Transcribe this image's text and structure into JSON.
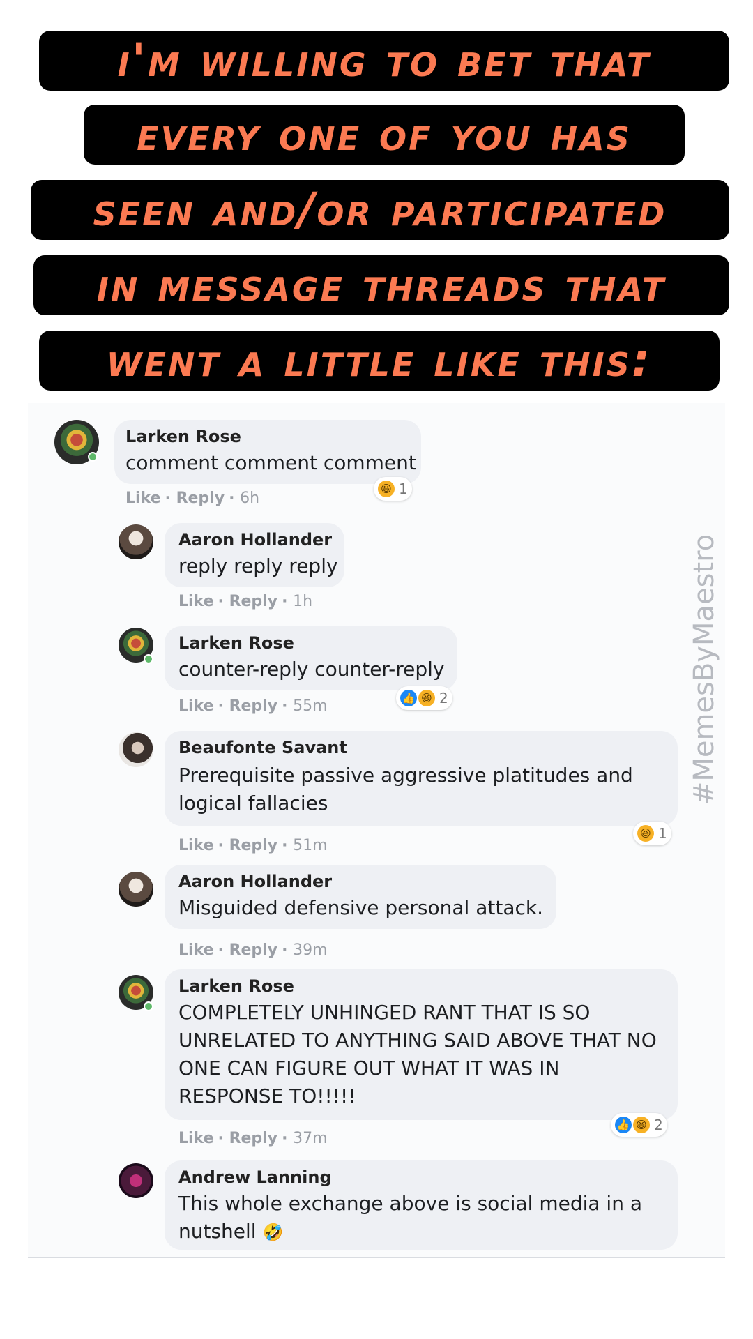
{
  "caption": {
    "lines": [
      "I'm willing to bet that",
      "every one of you has",
      "seen and/or participated",
      "in message threads that",
      "went a little like this:"
    ]
  },
  "watermark": "#MemesByMaestro",
  "comments": [
    {
      "author": "Larken Rose",
      "text": "comment comment comment",
      "like": "Like",
      "reply": "Reply",
      "time": "6h",
      "reaction_count": "1"
    },
    {
      "author": "Aaron Hollander",
      "text": "reply reply reply",
      "like": "Like",
      "reply": "Reply",
      "time": "1h"
    },
    {
      "author": "Larken Rose",
      "text": "counter-reply counter-reply",
      "like": "Like",
      "reply": "Reply",
      "time": "55m",
      "reaction_count": "2"
    },
    {
      "author": "Beaufonte Savant",
      "text": "Prerequisite passive aggressive platitudes and logical fallacies",
      "like": "Like",
      "reply": "Reply",
      "time": "51m",
      "reaction_count": "1"
    },
    {
      "author": "Aaron Hollander",
      "text": "Misguided defensive personal attack.",
      "like": "Like",
      "reply": "Reply",
      "time": "39m"
    },
    {
      "author": "Larken Rose",
      "text": "COMPLETELY UNHINGED RANT THAT IS SO UNRELATED TO ANYTHING SAID ABOVE THAT NO ONE CAN FIGURE OUT WHAT IT WAS IN RESPONSE TO!!!!!",
      "like": "Like",
      "reply": "Reply",
      "time": "37m",
      "reaction_count": "2"
    },
    {
      "author": "Andrew Lanning",
      "text": "This whole exchange above is social media in a nutshell",
      "emoji": "🤣",
      "like": "Like",
      "reply": "Reply"
    }
  ],
  "colors": {
    "caption_text": "#fb7a52",
    "caption_bg": "#000000",
    "bubble_bg": "#eef0f4",
    "like_blue": "#1b87f5",
    "haha_yellow": "#f7b125",
    "online_green": "#5fb96a"
  },
  "icons": {
    "haha_reaction": "haha-reaction-icon",
    "like_reaction": "like-reaction-icon",
    "laughing_emoji": "rolling-laughing-emoji-icon"
  }
}
